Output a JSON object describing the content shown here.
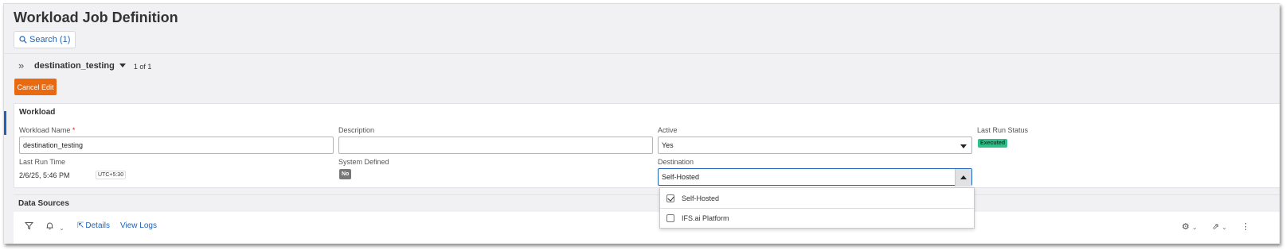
{
  "page": {
    "title": "Workload Job Definition"
  },
  "search": {
    "label": "Search (1)"
  },
  "record": {
    "name": "destination_testing",
    "count": "1 of 1"
  },
  "actions": {
    "cancel_edit": "Cancel Edit"
  },
  "workload": {
    "group_title": "Workload",
    "fields": {
      "workload_name": {
        "label": "Workload Name",
        "required_mark": "*",
        "value": "destination_testing"
      },
      "description": {
        "label": "Description",
        "value": ""
      },
      "active": {
        "label": "Active",
        "value": "Yes"
      },
      "last_run_status": {
        "label": "Last Run Status",
        "value": "Executed",
        "color": "#2fc08a"
      },
      "last_run_time": {
        "label": "Last Run Time",
        "value": "2/6/25, 5:46 PM",
        "timezone": "UTC+5:30"
      },
      "system_defined": {
        "label": "System Defined",
        "value": "No"
      },
      "destination": {
        "label": "Destination",
        "value": "Self-Hosted"
      }
    }
  },
  "destination_dropdown": {
    "options": [
      {
        "label": "Self-Hosted",
        "checked": true
      },
      {
        "label": "IFS.ai Platform",
        "checked": false
      }
    ]
  },
  "data_sources": {
    "title": "Data Sources",
    "toolbar": {
      "details": "Details",
      "view_logs": "View Logs"
    }
  },
  "colors": {
    "accent": "#1f63b8",
    "cancel": "#e8690f"
  }
}
